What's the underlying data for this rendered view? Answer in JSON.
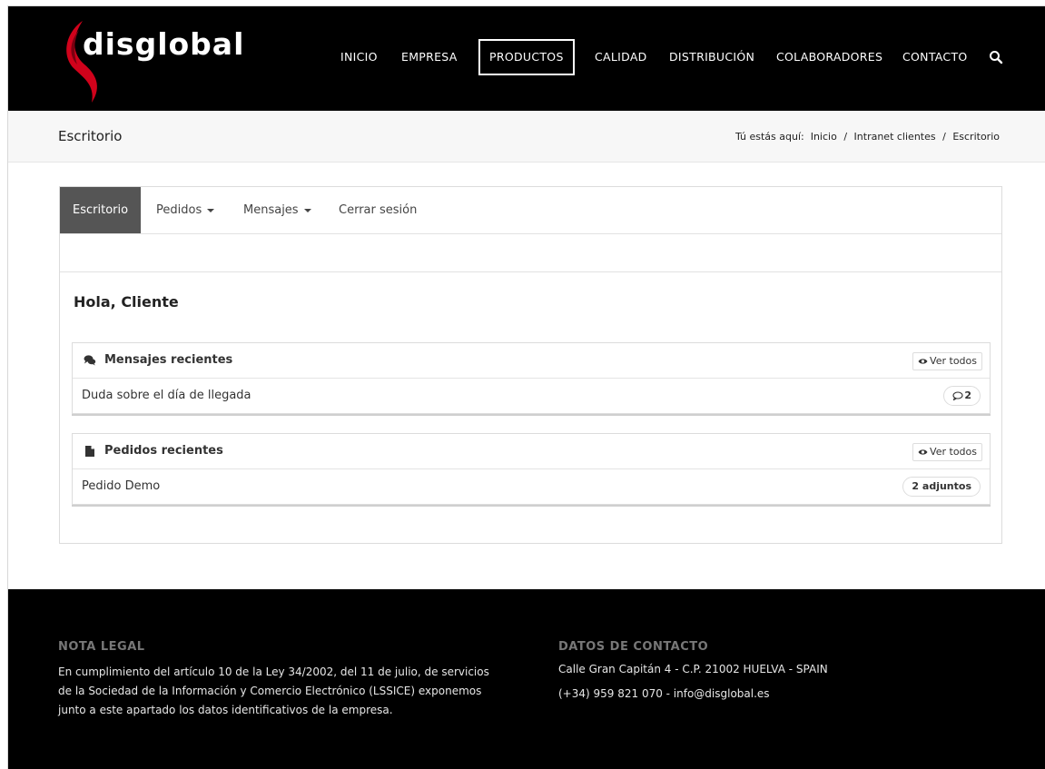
{
  "header": {
    "logo_text": "disglobal",
    "nav": [
      {
        "label": "INICIO",
        "active": false
      },
      {
        "label": "EMPRESA",
        "active": false
      },
      {
        "label": "PRODUCTOS",
        "active": true
      },
      {
        "label": "CALIDAD",
        "active": false
      },
      {
        "label": "DISTRIBUCIÓN",
        "active": false
      },
      {
        "label": "COLABORADORES",
        "active": false
      },
      {
        "label": "CONTACTO",
        "active": false
      }
    ],
    "search_icon": "search-icon"
  },
  "titlebar": {
    "title": "Escritorio",
    "breadcrumb_prefix": "Tú estás aquí:",
    "breadcrumb": [
      "Inicio",
      "Intranet clientes",
      "Escritorio"
    ],
    "separator": "/"
  },
  "dashboard": {
    "tabs": [
      {
        "label": "Escritorio",
        "active": true,
        "dropdown": false
      },
      {
        "label": "Pedidos",
        "active": false,
        "dropdown": true
      },
      {
        "label": "Mensajes",
        "active": false,
        "dropdown": true
      },
      {
        "label": "Cerrar sesión",
        "active": false,
        "dropdown": false
      }
    ],
    "greeting": "Hola, Cliente",
    "messages": {
      "title": "Mensajes recientes",
      "icon": "comments-icon",
      "view_all": "Ver todos",
      "items": [
        {
          "label": "Duda sobre el día de llegada",
          "count": "2"
        }
      ]
    },
    "orders": {
      "title": "Pedidos recientes",
      "icon": "file-icon",
      "view_all": "Ver todos",
      "items": [
        {
          "label": "Pedido Demo",
          "badge": "2 adjuntos"
        }
      ]
    }
  },
  "footer": {
    "legal_heading": "NOTA LEGAL",
    "legal_lines": [
      "En cumplimiento del artículo 10 de la Ley 34/2002, del 11 de julio, de servicios",
      "de la Sociedad de la Información y Comercio Electrónico (LSSICE) exponemos",
      "junto a este apartado los datos identificativos de la empresa."
    ],
    "contact_heading": "DATOS DE CONTACTO",
    "address": "Calle Gran Capitán 4 - C.P. 21002 HUELVA - SPAIN",
    "phone_email": "(+34) 959 821 070 - info@disglobal.es"
  },
  "colors": {
    "header_bg": "#000000",
    "logo_red": "#d0021b",
    "active_tab": "#555555",
    "footer_heading": "#777777"
  }
}
